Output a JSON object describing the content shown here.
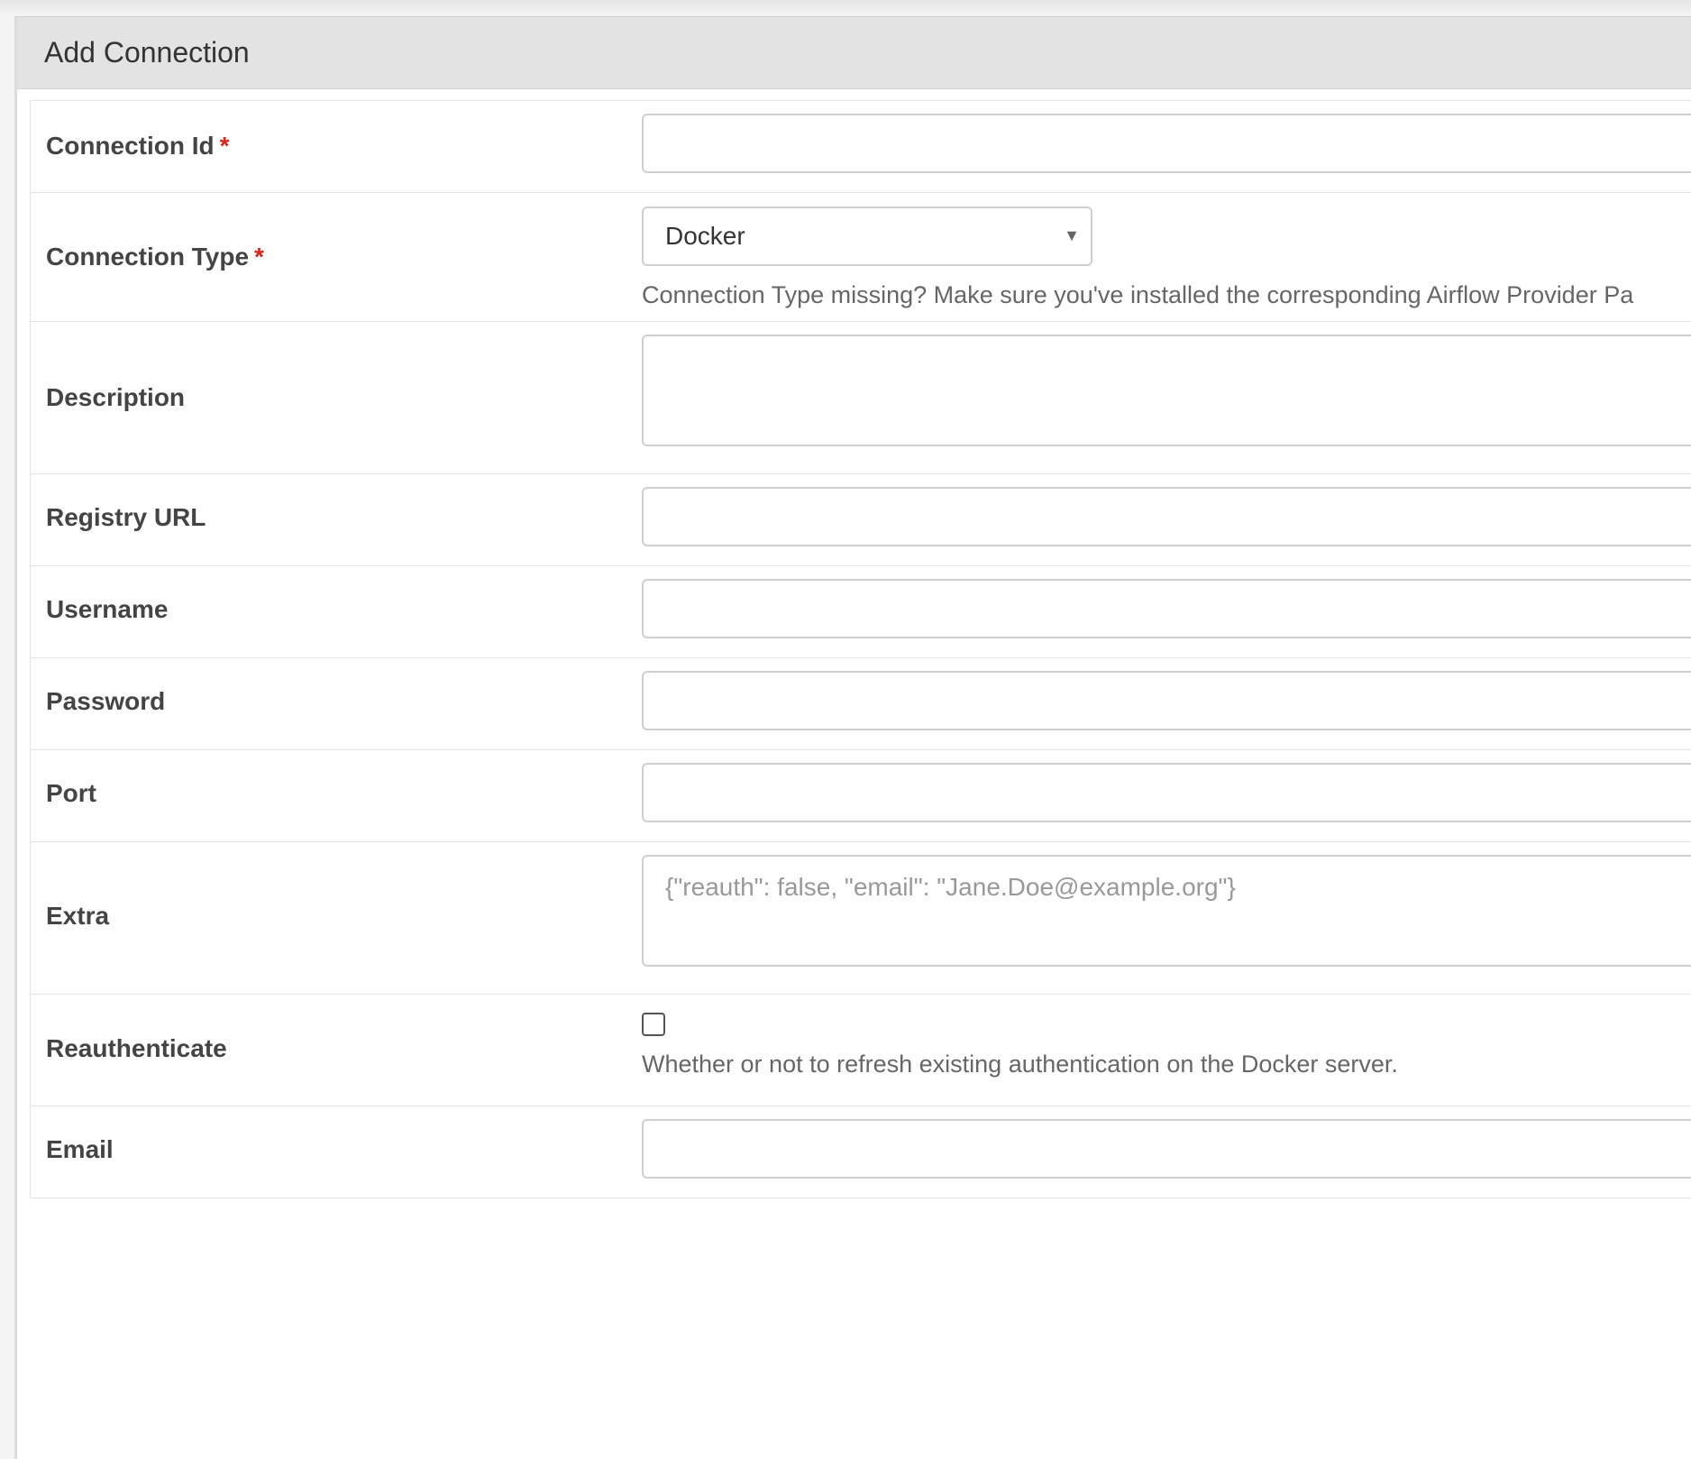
{
  "header": {
    "title": "Add Connection"
  },
  "required_mark": "*",
  "form": {
    "connection_id": {
      "label": "Connection Id",
      "value": "",
      "placeholder": ""
    },
    "connection_type": {
      "label": "Connection Type",
      "selected": "Docker",
      "help": "Connection Type missing? Make sure you've installed the corresponding Airflow Provider Pa"
    },
    "description": {
      "label": "Description",
      "value": "",
      "placeholder": ""
    },
    "registry_url": {
      "label": "Registry URL",
      "value": "",
      "placeholder": ""
    },
    "username": {
      "label": "Username",
      "value": "",
      "placeholder": ""
    },
    "password": {
      "label": "Password",
      "value": "",
      "placeholder": ""
    },
    "port": {
      "label": "Port",
      "value": "",
      "placeholder": ""
    },
    "extra": {
      "label": "Extra",
      "value": "",
      "placeholder": "{\"reauth\": false, \"email\": \"Jane.Doe@example.org\"}"
    },
    "reauthenticate": {
      "label": "Reauthenticate",
      "checked": false,
      "help": "Whether or not to refresh existing authentication on the Docker server."
    },
    "email": {
      "label": "Email",
      "value": "",
      "placeholder": ""
    }
  }
}
